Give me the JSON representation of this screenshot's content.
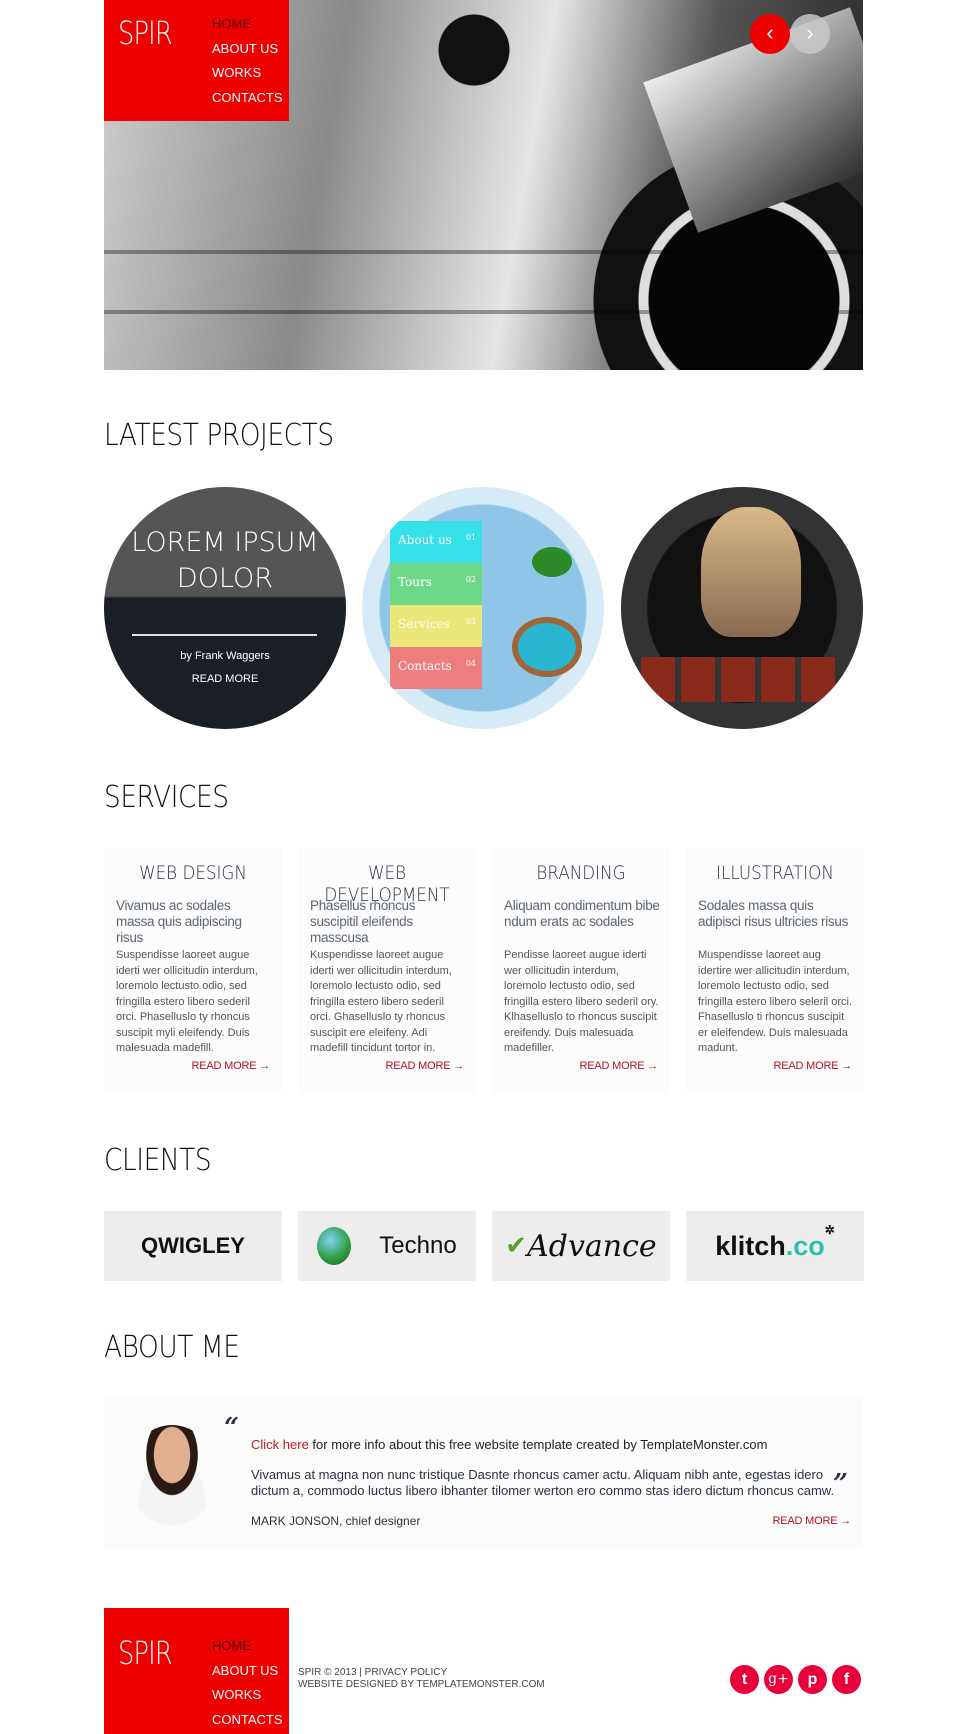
{
  "header": {
    "logo": "SPIR",
    "nav": [
      "HOME",
      "ABOUT US",
      "WORKS",
      "CONTACTS"
    ],
    "prev_icon": "chevron-left-icon",
    "next_icon": "chevron-right-icon"
  },
  "projects": {
    "title": "LATEST PROJECTS",
    "featured": {
      "title_line1": "LOREM IPSUM",
      "title_line2": "DOLOR",
      "author": "by Frank Waggers",
      "link": "READ MORE"
    },
    "menu_thumb": [
      {
        "label": "About us",
        "num": "01",
        "color": "#35e0e8"
      },
      {
        "label": "Tours",
        "num": "02",
        "color": "#6ed889"
      },
      {
        "label": "Services",
        "num": "03",
        "color": "#ece779"
      },
      {
        "label": "Contacts",
        "num": "04",
        "color": "#f07d7d"
      }
    ]
  },
  "services": {
    "title": "SERVICES",
    "items": [
      {
        "title": "WEB DESIGN",
        "subtitle": "Vivamus ac sodales massa quis adipiscing risus",
        "body": "Suspendisse laoreet augue iderti wer ollicitudin interdum, loremolo lectusto odio, sed fringilla estero libero sederil orci. Phaselluslo ty rhoncus suscipit myli eleifendy. Duis malesuada madefill.",
        "link": "READ MORE"
      },
      {
        "title": "WEB DEVELOPMENT",
        "subtitle": "Phasellus rhoncus suscipitil eleifends masscusa",
        "body": "Kuspendisse laoreet augue iderti wer ollicitudin interdum, loremolo lectusto odio, sed fringilla estero libero sederil orci. Ghaselluslo ty rhoncus suscipit ere eleifeny. Adi madefill tincidunt tortor in.",
        "link": "READ MORE"
      },
      {
        "title": "BRANDING",
        "subtitle": "Aliquam condimentum bibe ndum erats ac sodales",
        "body": "Pendisse laoreet augue iderti wer ollicitudin interdum, loremolo lectusto odio, sed fringilla estero libero sederil ory. Klhaselluslo to rhoncus suscipit ereifendy. Duis malesuada madefiller.",
        "link": "READ MORE"
      },
      {
        "title": "ILLUSTRATION",
        "subtitle": "Sodales massa quis adipisci risus ultricies risus",
        "body": "Muspendisse laoreet aug idertire wer allicitudin interdum, loremolo lectusto odio, sed fringilla estero libero seleril orci. Fhaselluslo ti rhoncus suscipit er  eleifendew. Duis malesuada madunt.",
        "link": "READ MORE"
      }
    ]
  },
  "clients": {
    "title": "CLIENTS",
    "logos": [
      "QWIGLEY",
      "Techno",
      "Advance",
      "klitch",
      "co"
    ]
  },
  "about": {
    "title": "ABOUT ME",
    "link_text": "Click here",
    "intro": " for more info about this free website template created by TemplateMonster.com",
    "quote": "Vivamus at magna non nunc tristique Dasnte rhoncus camer actu. Aliquam nibh ante, egestas idero dictum a, commodo luctus libero ibhanter tilomer werton ero commo stas idero dictum rhoncus camw.",
    "name": "MARK JONSON",
    "role": ", chief designer",
    "link": "READ MORE"
  },
  "footer": {
    "copyright": "SPIR © 2013 | ",
    "privacy": "PRIVACY POLICY",
    "credit": "WEBSITE DESIGNED BY TEMPLATEMONSTER.COM",
    "social": [
      "twitter-icon",
      "google-plus-icon",
      "pinterest-icon",
      "facebook-icon"
    ]
  },
  "colors": {
    "accent": "#ec0000",
    "link": "#b3121f",
    "social": "#e8003a"
  }
}
